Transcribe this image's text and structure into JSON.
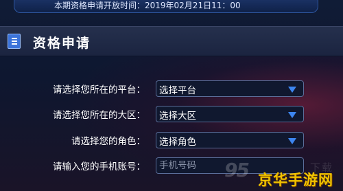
{
  "banner": {
    "text": "本期资格申请开放时间：2019年02月21日11：00"
  },
  "section": {
    "title": "资格申请",
    "icon": "list-icon"
  },
  "form": {
    "rows": [
      {
        "label": "请选择您所在的平台：",
        "value": "选择平台",
        "type": "select"
      },
      {
        "label": "请选择您所在的大区：",
        "value": "选择大区",
        "type": "select"
      },
      {
        "label": "请选择您的角色：",
        "value": "选择角色",
        "type": "select"
      },
      {
        "label": "请输入您的手机账号：",
        "placeholder": "手机号码",
        "type": "input"
      }
    ]
  },
  "watermark": {
    "number": "95",
    "ghost_text": "下载",
    "logo_text": "京华手游网"
  },
  "colors": {
    "accent": "#3d86f0",
    "logo": "#f2c400",
    "background": "#101c36"
  }
}
